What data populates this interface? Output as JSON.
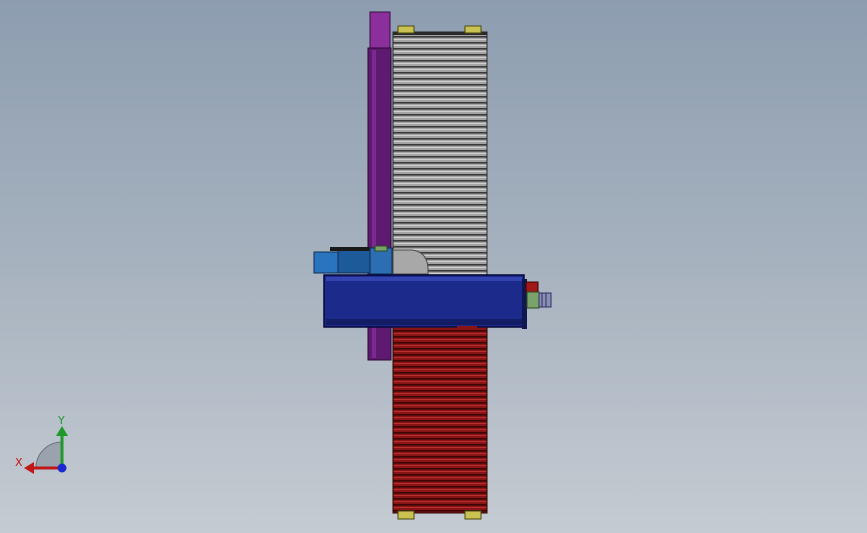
{
  "viewport": {
    "background_top": "#8d9db0",
    "background_bottom": "#c5cbd2"
  },
  "model": {
    "colors": {
      "upper_bellows": "#9a9a9a",
      "lower_bellows": "#8a1414",
      "carriage": "#1c2a8c",
      "column": "#6a1f7e",
      "coupler": "#1e62a8",
      "fitting_green": "#7aa36a",
      "mount_yellow": "#c9c250",
      "valve_red": "#a01818"
    },
    "icon": "cad-assembly-linear-actuator"
  },
  "triad": {
    "y_label": "Y",
    "x_label": "X",
    "y_color": "#1f9a2a",
    "x_color": "#c01818",
    "z_color": "#1a2ad0"
  }
}
